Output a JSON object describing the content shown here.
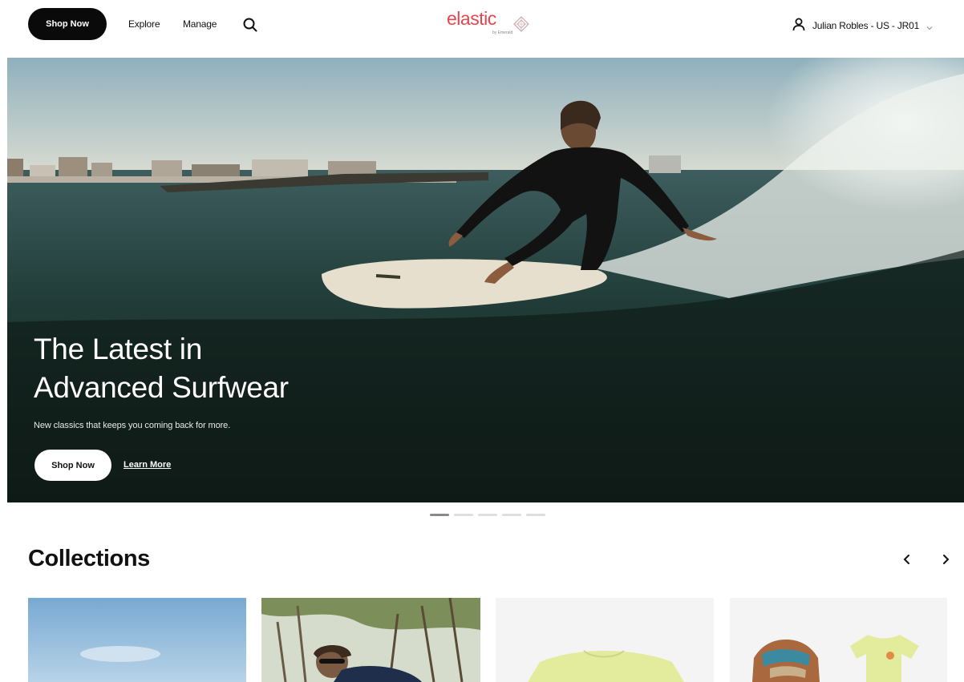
{
  "header": {
    "shop_now_label": "Shop Now",
    "nav": [
      {
        "label": "Explore"
      },
      {
        "label": "Manage"
      }
    ],
    "search_icon": "search-icon",
    "logo": {
      "wordmark": "elastic",
      "sub": "by Emerald"
    },
    "account": {
      "name": "Julian Robles - US - JR01",
      "icon": "user-icon"
    }
  },
  "hero": {
    "title": "The Latest in Advanced Surfwear",
    "subtitle": "New classics that keeps you coming back for more.",
    "shop_label": "Shop Now",
    "learn_label": "Learn More",
    "slide_count": 5,
    "active_slide": 1
  },
  "collections": {
    "title": "Collections",
    "prev_icon": "chevron-left-icon",
    "next_icon": "chevron-right-icon"
  },
  "colors": {
    "brand": "#e8464f",
    "button_dark": "#0a0a0a"
  }
}
